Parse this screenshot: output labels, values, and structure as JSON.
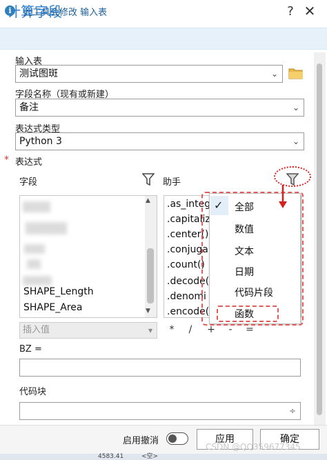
{
  "window": {
    "title": "计算字段",
    "help_label": "?",
    "close_label": "✕"
  },
  "banner": {
    "icon": "info-icon",
    "text": "此工具会修改 输入表"
  },
  "input_table": {
    "label": "输入表",
    "value": "测试图斑",
    "folder_icon": "folder-icon"
  },
  "field_name": {
    "label": "字段名称（现有或新建）",
    "value": "备注"
  },
  "expression_type": {
    "label": "表达式类型",
    "value": "Python 3"
  },
  "expression": {
    "required_mark": "*",
    "label": "表达式",
    "fields_header": "字段",
    "helper_header": "助手",
    "fields": [
      "SHAPE_Length",
      "SHAPE_Area"
    ],
    "helpers": [
      ".as_integ",
      ".capitaliz",
      ".center()",
      ".conjuga",
      ".count()",
      ".decode(",
      ".denomi",
      ".encode("
    ],
    "insert_value_placeholder": "插入值",
    "operators": [
      "*",
      "/",
      "+",
      "-",
      "="
    ]
  },
  "filter_menu": {
    "checked_index": 0,
    "items": [
      "全部",
      "数值",
      "文本",
      "日期",
      "代码片段",
      "函数"
    ]
  },
  "expression_text": {
    "label": "BZ ="
  },
  "code_block": {
    "label": "代码块"
  },
  "footer": {
    "undo_label": "启用撤消",
    "apply_label": "应用",
    "ok_label": "确定",
    "watermark": "CSDN @QQ359677345",
    "status_values": [
      "4583.41",
      "<空>"
    ]
  },
  "colors": {
    "accent": "#2a7fd4",
    "annotation": "#e35a5a",
    "banner_bg": "#e6f1fa"
  }
}
